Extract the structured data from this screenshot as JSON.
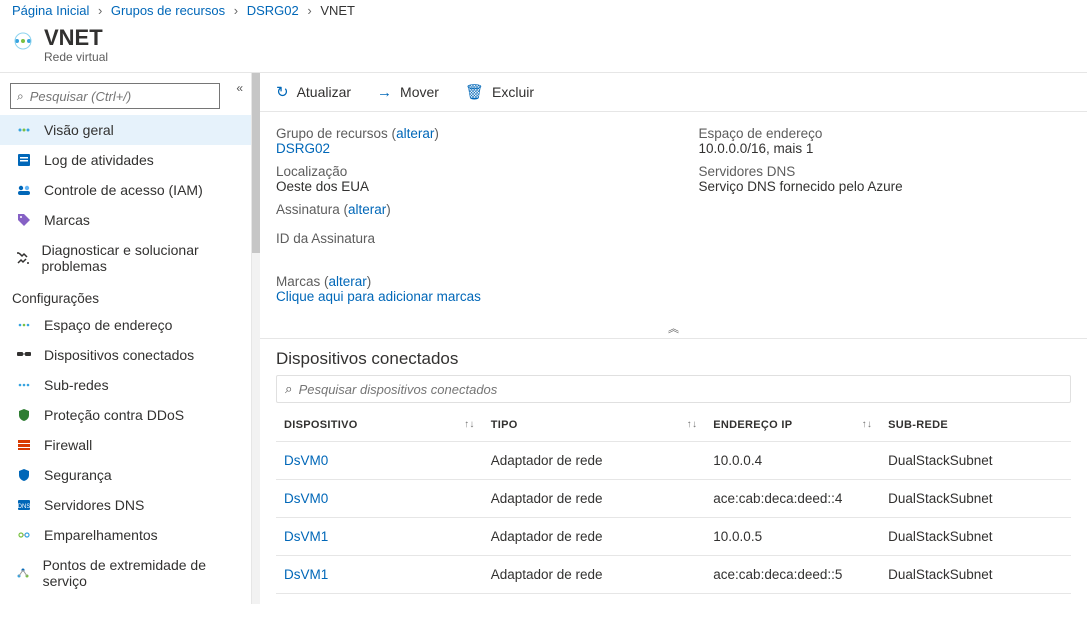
{
  "breadcrumb": {
    "home": "Página Inicial",
    "rg": "Grupos de recursos",
    "rgname": "DSRG02",
    "current": "VNET"
  },
  "header": {
    "title": "VNET",
    "subtitle": "Rede virtual"
  },
  "sidebar": {
    "search_placeholder": "Pesquisar (Ctrl+/)",
    "items_main": [
      {
        "label": "Visão geral",
        "active": true,
        "ikey": "overview"
      },
      {
        "label": "Log de atividades",
        "ikey": "activity"
      },
      {
        "label": "Controle de acesso (IAM)",
        "ikey": "iam"
      },
      {
        "label": "Marcas",
        "ikey": "tags"
      },
      {
        "label": "Diagnosticar e solucionar problemas",
        "ikey": "diag"
      }
    ],
    "section_config": "Configurações",
    "items_config": [
      {
        "label": "Espaço de endereço",
        "ikey": "addrspace"
      },
      {
        "label": "Dispositivos conectados",
        "ikey": "devices"
      },
      {
        "label": "Sub-redes",
        "ikey": "subnets"
      },
      {
        "label": "Proteção contra DDoS",
        "ikey": "ddos"
      },
      {
        "label": "Firewall",
        "ikey": "firewall"
      },
      {
        "label": "Segurança",
        "ikey": "security"
      },
      {
        "label": "Servidores DNS",
        "ikey": "dns"
      },
      {
        "label": "Emparelhamentos",
        "ikey": "peerings"
      },
      {
        "label": "Pontos de extremidade de serviço",
        "ikey": "endpoints"
      }
    ]
  },
  "toolbar": {
    "refresh": "Atualizar",
    "move": "Mover",
    "delete": "Excluir"
  },
  "essentials": {
    "left": {
      "rg_label_pre": "Grupo de recursos (",
      "rg_change": "alterar",
      "rg_label_post": ")",
      "rg_value": "DSRG02",
      "loc_label": "Localização",
      "loc_value": "Oeste dos EUA",
      "sub_label_pre": "Assinatura (",
      "sub_change": "alterar",
      "sub_label_post": ")",
      "subid_label": "ID da Assinatura",
      "tags_label_pre": "Marcas (",
      "tags_change": "alterar",
      "tags_label_post": ")",
      "tags_add": "Clique aqui para adicionar marcas"
    },
    "right": {
      "addr_label": "Espaço de endereço",
      "addr_value": "10.0.0.0/16, mais 1",
      "dns_label": "Servidores DNS",
      "dns_value": "Serviço DNS fornecido pelo Azure"
    }
  },
  "devices": {
    "title": "Dispositivos conectados",
    "search_ph": "Pesquisar dispositivos conectados",
    "columns": {
      "device": "DISPOSITIVO",
      "type": "TIPO",
      "ip": "ENDEREÇO IP",
      "subnet": "SUB-REDE"
    },
    "rows": [
      {
        "device": "DsVM0",
        "type": "Adaptador de rede",
        "ip": "10.0.0.4",
        "subnet": "DualStackSubnet"
      },
      {
        "device": "DsVM0",
        "type": "Adaptador de rede",
        "ip": "ace:cab:deca:deed::4",
        "subnet": "DualStackSubnet"
      },
      {
        "device": "DsVM1",
        "type": "Adaptador de rede",
        "ip": "10.0.0.5",
        "subnet": "DualStackSubnet"
      },
      {
        "device": "DsVM1",
        "type": "Adaptador de rede",
        "ip": "ace:cab:deca:deed::5",
        "subnet": "DualStackSubnet"
      }
    ]
  }
}
